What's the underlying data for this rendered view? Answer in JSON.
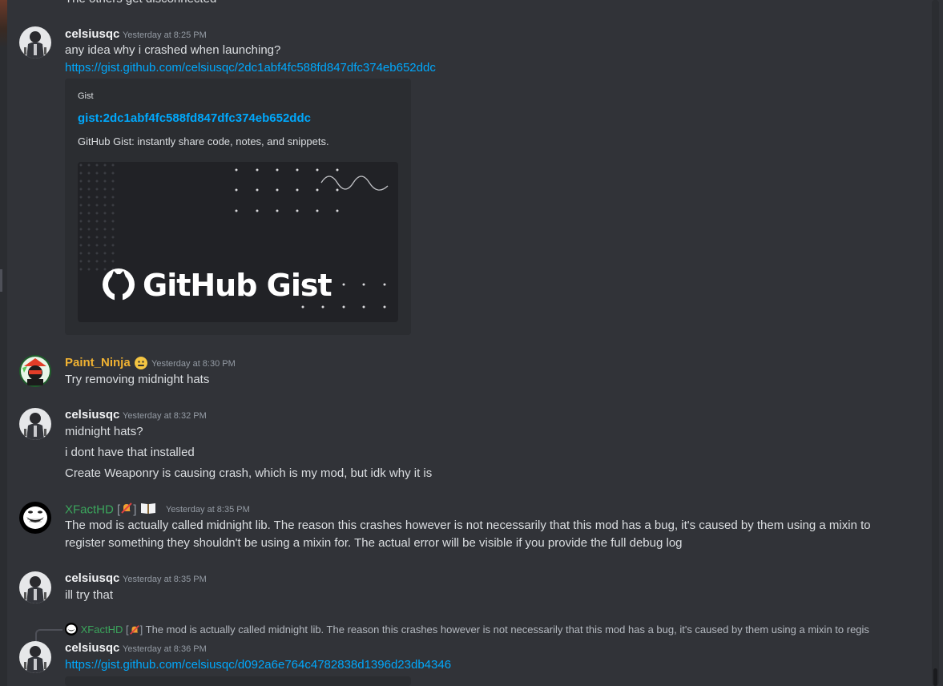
{
  "top_cut_text": "The others get disconnected",
  "messages": [
    {
      "username": "celsiusqc",
      "timestamp": "Yesterday at 8:25 PM",
      "lines": [
        "any idea why i crashed when launching?"
      ],
      "link": "https://gist.github.com/celsiusqc/2dc1abf4fc588fd847dfc374eb652ddc",
      "embed": {
        "provider": "Gist",
        "title": "gist:2dc1abf4fc588fd847dfc374eb652ddc",
        "description": "GitHub Gist: instantly share code, notes, and snippets.",
        "image_logo_text": "GitHub Gist"
      }
    },
    {
      "username": "Paint_Ninja",
      "timestamp": "Yesterday at 8:30 PM",
      "lines": [
        "Try removing midnight hats"
      ]
    },
    {
      "username": "celsiusqc",
      "timestamp": "Yesterday at 8:32 PM",
      "lines": [
        "midnight hats?",
        "i dont have that installed",
        "Create Weaponry is causing crash, which is my mod, but idk why it is"
      ]
    },
    {
      "username": "XFactHD",
      "bracket_open": "[",
      "bracket_close": "]",
      "timestamp": "Yesterday at 8:35 PM",
      "lines": [
        "The mod is actually called midnight lib. The reason this crashes however is not necessarily that this mod has a bug, it's caused by them using a mixin to",
        "register something they shouldn't be using a mixin for. The actual error will be visible if you provide the full debug log"
      ]
    },
    {
      "username": "celsiusqc",
      "timestamp": "Yesterday at 8:35 PM",
      "lines": [
        "ill try that"
      ]
    },
    {
      "reply": {
        "username": "XFactHD",
        "bracket_open": "[",
        "bracket_close": "]",
        "text": "The mod is actually called midnight lib. The reason this crashes however is not necessarily that this mod has a bug, it's caused by them using a mixin to regis"
      },
      "username": "celsiusqc",
      "timestamp": "Yesterday at 8:36 PM",
      "link": "https://gist.github.com/celsiusqc/d092a6e764c4782838d1396d23db4346"
    }
  ],
  "colors": {
    "background": "#313338",
    "text": "#dbdee1",
    "link": "#00a8fc",
    "timestamp": "#949ba4",
    "paint_ninja": "#f0b232",
    "xfacthd": "#3ba55c",
    "embed_bg": "#2b2d31"
  },
  "icons": {
    "paint_ninja_badge": "face-emoji-icon",
    "xfacthd_badge_1": "no-bell-icon",
    "xfacthd_badge_2": "open-book-icon"
  }
}
